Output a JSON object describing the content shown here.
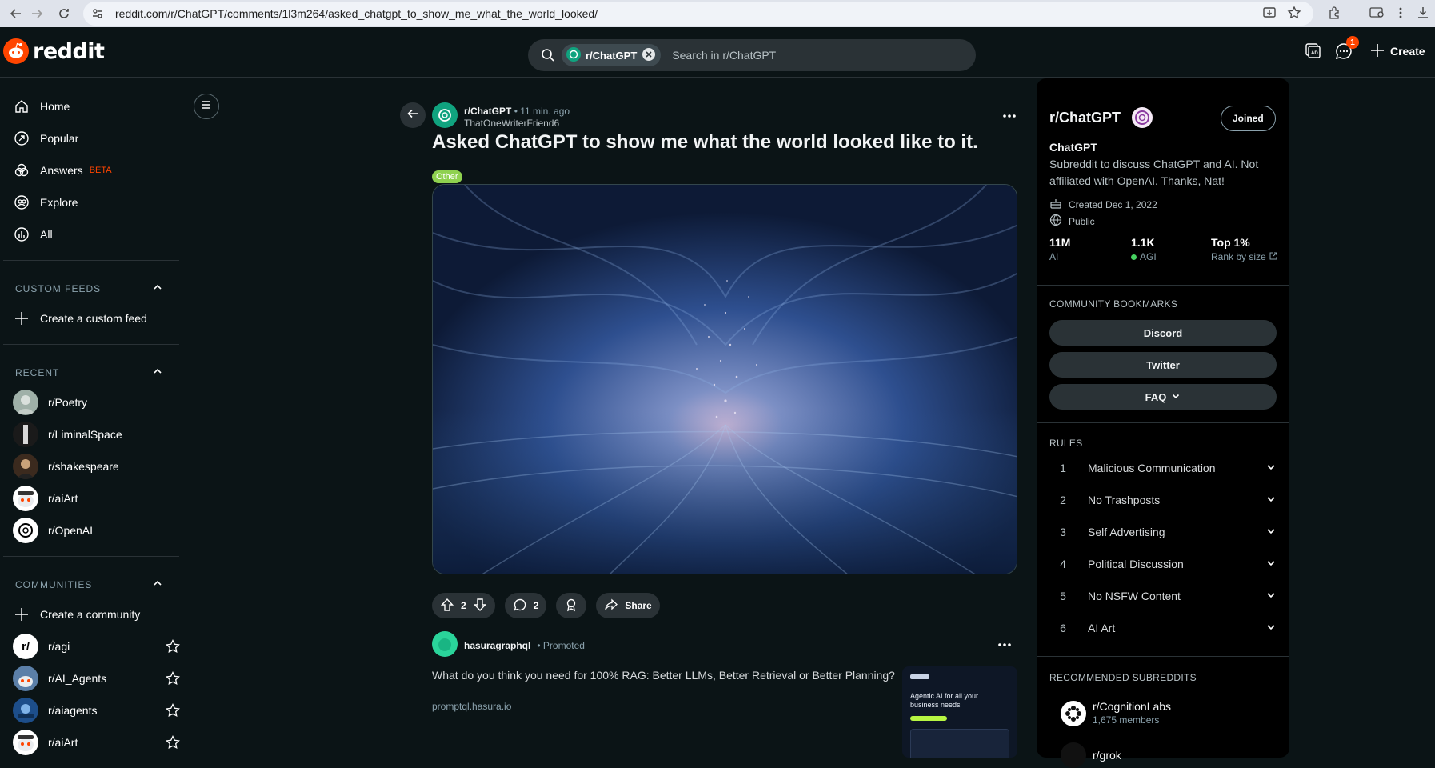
{
  "browser": {
    "url": "reddit.com/r/ChatGPT/comments/1l3m264/asked_chatgpt_to_show_me_what_the_world_looked/"
  },
  "header": {
    "logo_text": "reddit",
    "search_chip": "r/ChatGPT",
    "search_placeholder": "Search in r/ChatGPT",
    "notification_count": "1",
    "create_label": "Create"
  },
  "sidebar": {
    "nav": [
      {
        "label": "Home",
        "icon": "home-icon"
      },
      {
        "label": "Popular",
        "icon": "popular-icon"
      },
      {
        "label": "Answers",
        "badge": "BETA",
        "icon": "answers-icon"
      },
      {
        "label": "Explore",
        "icon": "explore-icon"
      },
      {
        "label": "All",
        "icon": "all-icon"
      }
    ],
    "custom_feeds": {
      "title": "CUSTOM FEEDS",
      "create": "Create a custom feed"
    },
    "recent": {
      "title": "RECENT",
      "items": [
        "r/Poetry",
        "r/LiminalSpace",
        "r/shakespeare",
        "r/aiArt",
        "r/OpenAI"
      ]
    },
    "communities": {
      "title": "COMMUNITIES",
      "create": "Create a community",
      "items": [
        "r/agi",
        "r/AI_Agents",
        "r/aiagents",
        "r/aiArt"
      ]
    }
  },
  "post": {
    "subreddit": "r/ChatGPT",
    "time": "• 11 min. ago",
    "author": "ThatOneWriterFriend6",
    "title": "Asked ChatGPT to show me what the world looked like to it.",
    "flair": "Other",
    "votes": "2",
    "comments": "2",
    "share": "Share"
  },
  "promoted": {
    "author": "hasuragraphql",
    "label": "• Promoted",
    "text": "What do you think you need for 100% RAG: Better LLMs, Better Retrieval or Better Planning?",
    "link": "promptql.hasura.io",
    "thumb_title": "Agentic AI for all your business needs"
  },
  "community": {
    "title": "r/ChatGPT",
    "joined": "Joined",
    "name": "ChatGPT",
    "description": "Subreddit to discuss ChatGPT and AI. Not affiliated with OpenAI. Thanks, Nat!",
    "created": "Created Dec 1, 2022",
    "visibility": "Public",
    "stats": [
      {
        "value": "11M",
        "label": "AI"
      },
      {
        "value": "1.1K",
        "label": "AGI"
      },
      {
        "value": "Top 1%",
        "label": "Rank by size"
      }
    ],
    "bookmarks_title": "COMMUNITY BOOKMARKS",
    "bookmarks": [
      "Discord",
      "Twitter",
      "FAQ"
    ],
    "rules_title": "RULES",
    "rules": [
      {
        "n": "1",
        "t": "Malicious Communication"
      },
      {
        "n": "2",
        "t": "No Trashposts"
      },
      {
        "n": "3",
        "t": "Self Advertising"
      },
      {
        "n": "4",
        "t": "Political Discussion"
      },
      {
        "n": "5",
        "t": "No NSFW Content"
      },
      {
        "n": "6",
        "t": "AI Art"
      }
    ],
    "recommended_title": "RECOMMENDED SUBREDDITS",
    "recommended": [
      {
        "name": "r/CognitionLabs",
        "members": "1,675 members"
      },
      {
        "name": "r/grok",
        "members": ""
      }
    ]
  },
  "colors": {
    "accent": "#ff4500",
    "online": "#46d160",
    "flair": "#8fd14f",
    "beta": "#ff4500"
  }
}
